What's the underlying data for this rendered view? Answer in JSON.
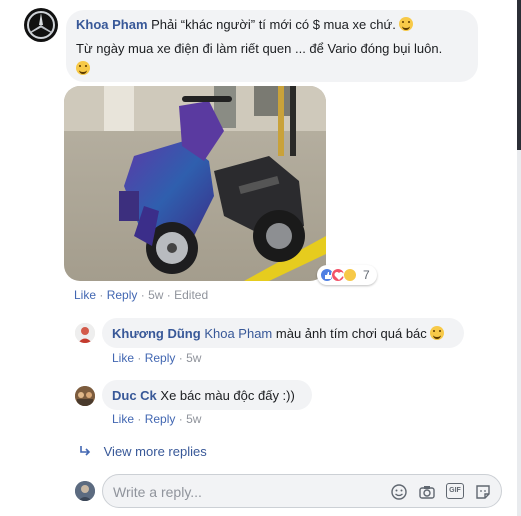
{
  "post_comment": {
    "author": "Khoa Pham",
    "line1": "Phải “khác người” tí mới có $ mua xe chứ.",
    "line2": "Từ ngày mua xe điện đi làm riết quen ... để Vario đóng bụi luôn.",
    "reaction_count": "7",
    "actions": {
      "like": "Like",
      "reply": "Reply",
      "time": "5w",
      "edited": "Edited",
      "separator": "·"
    }
  },
  "replies": [
    {
      "author": "Khương Dũng",
      "mention": "Khoa Pham",
      "text": "màu ảnh tím chơi quá bác",
      "actions": {
        "like": "Like",
        "reply": "Reply",
        "time": "5w"
      }
    },
    {
      "author": "Duc Ck",
      "text": "Xe bác màu độc đấy :))",
      "actions": {
        "like": "Like",
        "reply": "Reply",
        "time": "5w"
      }
    }
  ],
  "view_more": "View more replies",
  "reply_box": {
    "placeholder": "Write a reply...",
    "gif_label": "GIF"
  },
  "reaction_icons": [
    "like-reaction-icon",
    "love-reaction-icon",
    "haha-reaction-icon"
  ],
  "colors": {
    "name_blue": "#385898",
    "action_blue": "#4267b2",
    "bubble_bg": "#f2f3f5",
    "meta_grey": "#90949c"
  }
}
